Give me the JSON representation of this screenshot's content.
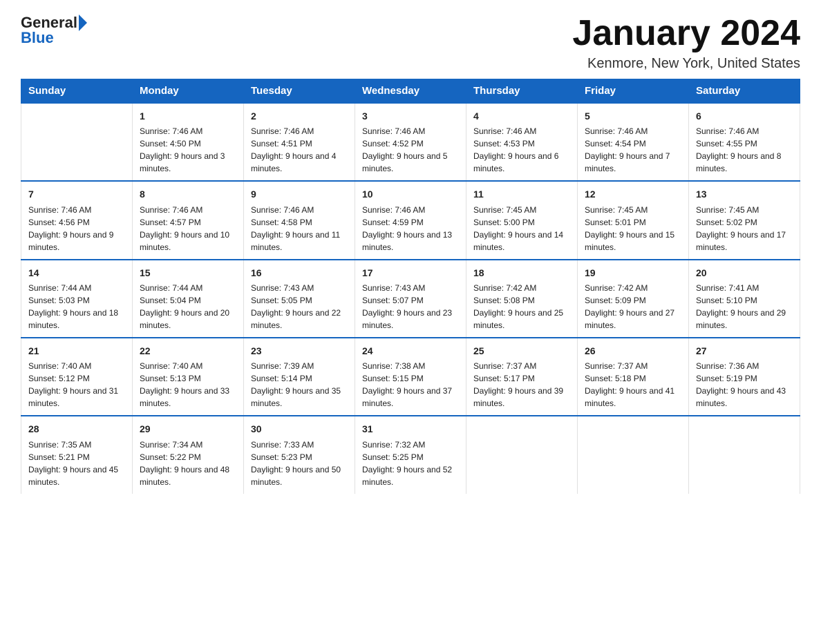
{
  "header": {
    "logo": {
      "text_general": "General",
      "arrow_label": "arrow-icon",
      "text_blue": "Blue"
    },
    "title": "January 2024",
    "location": "Kenmore, New York, United States"
  },
  "calendar": {
    "weekdays": [
      "Sunday",
      "Monday",
      "Tuesday",
      "Wednesday",
      "Thursday",
      "Friday",
      "Saturday"
    ],
    "weeks": [
      [
        {
          "day": "",
          "sunrise": "",
          "sunset": "",
          "daylight": ""
        },
        {
          "day": "1",
          "sunrise": "Sunrise: 7:46 AM",
          "sunset": "Sunset: 4:50 PM",
          "daylight": "Daylight: 9 hours and 3 minutes."
        },
        {
          "day": "2",
          "sunrise": "Sunrise: 7:46 AM",
          "sunset": "Sunset: 4:51 PM",
          "daylight": "Daylight: 9 hours and 4 minutes."
        },
        {
          "day": "3",
          "sunrise": "Sunrise: 7:46 AM",
          "sunset": "Sunset: 4:52 PM",
          "daylight": "Daylight: 9 hours and 5 minutes."
        },
        {
          "day": "4",
          "sunrise": "Sunrise: 7:46 AM",
          "sunset": "Sunset: 4:53 PM",
          "daylight": "Daylight: 9 hours and 6 minutes."
        },
        {
          "day": "5",
          "sunrise": "Sunrise: 7:46 AM",
          "sunset": "Sunset: 4:54 PM",
          "daylight": "Daylight: 9 hours and 7 minutes."
        },
        {
          "day": "6",
          "sunrise": "Sunrise: 7:46 AM",
          "sunset": "Sunset: 4:55 PM",
          "daylight": "Daylight: 9 hours and 8 minutes."
        }
      ],
      [
        {
          "day": "7",
          "sunrise": "Sunrise: 7:46 AM",
          "sunset": "Sunset: 4:56 PM",
          "daylight": "Daylight: 9 hours and 9 minutes."
        },
        {
          "day": "8",
          "sunrise": "Sunrise: 7:46 AM",
          "sunset": "Sunset: 4:57 PM",
          "daylight": "Daylight: 9 hours and 10 minutes."
        },
        {
          "day": "9",
          "sunrise": "Sunrise: 7:46 AM",
          "sunset": "Sunset: 4:58 PM",
          "daylight": "Daylight: 9 hours and 11 minutes."
        },
        {
          "day": "10",
          "sunrise": "Sunrise: 7:46 AM",
          "sunset": "Sunset: 4:59 PM",
          "daylight": "Daylight: 9 hours and 13 minutes."
        },
        {
          "day": "11",
          "sunrise": "Sunrise: 7:45 AM",
          "sunset": "Sunset: 5:00 PM",
          "daylight": "Daylight: 9 hours and 14 minutes."
        },
        {
          "day": "12",
          "sunrise": "Sunrise: 7:45 AM",
          "sunset": "Sunset: 5:01 PM",
          "daylight": "Daylight: 9 hours and 15 minutes."
        },
        {
          "day": "13",
          "sunrise": "Sunrise: 7:45 AM",
          "sunset": "Sunset: 5:02 PM",
          "daylight": "Daylight: 9 hours and 17 minutes."
        }
      ],
      [
        {
          "day": "14",
          "sunrise": "Sunrise: 7:44 AM",
          "sunset": "Sunset: 5:03 PM",
          "daylight": "Daylight: 9 hours and 18 minutes."
        },
        {
          "day": "15",
          "sunrise": "Sunrise: 7:44 AM",
          "sunset": "Sunset: 5:04 PM",
          "daylight": "Daylight: 9 hours and 20 minutes."
        },
        {
          "day": "16",
          "sunrise": "Sunrise: 7:43 AM",
          "sunset": "Sunset: 5:05 PM",
          "daylight": "Daylight: 9 hours and 22 minutes."
        },
        {
          "day": "17",
          "sunrise": "Sunrise: 7:43 AM",
          "sunset": "Sunset: 5:07 PM",
          "daylight": "Daylight: 9 hours and 23 minutes."
        },
        {
          "day": "18",
          "sunrise": "Sunrise: 7:42 AM",
          "sunset": "Sunset: 5:08 PM",
          "daylight": "Daylight: 9 hours and 25 minutes."
        },
        {
          "day": "19",
          "sunrise": "Sunrise: 7:42 AM",
          "sunset": "Sunset: 5:09 PM",
          "daylight": "Daylight: 9 hours and 27 minutes."
        },
        {
          "day": "20",
          "sunrise": "Sunrise: 7:41 AM",
          "sunset": "Sunset: 5:10 PM",
          "daylight": "Daylight: 9 hours and 29 minutes."
        }
      ],
      [
        {
          "day": "21",
          "sunrise": "Sunrise: 7:40 AM",
          "sunset": "Sunset: 5:12 PM",
          "daylight": "Daylight: 9 hours and 31 minutes."
        },
        {
          "day": "22",
          "sunrise": "Sunrise: 7:40 AM",
          "sunset": "Sunset: 5:13 PM",
          "daylight": "Daylight: 9 hours and 33 minutes."
        },
        {
          "day": "23",
          "sunrise": "Sunrise: 7:39 AM",
          "sunset": "Sunset: 5:14 PM",
          "daylight": "Daylight: 9 hours and 35 minutes."
        },
        {
          "day": "24",
          "sunrise": "Sunrise: 7:38 AM",
          "sunset": "Sunset: 5:15 PM",
          "daylight": "Daylight: 9 hours and 37 minutes."
        },
        {
          "day": "25",
          "sunrise": "Sunrise: 7:37 AM",
          "sunset": "Sunset: 5:17 PM",
          "daylight": "Daylight: 9 hours and 39 minutes."
        },
        {
          "day": "26",
          "sunrise": "Sunrise: 7:37 AM",
          "sunset": "Sunset: 5:18 PM",
          "daylight": "Daylight: 9 hours and 41 minutes."
        },
        {
          "day": "27",
          "sunrise": "Sunrise: 7:36 AM",
          "sunset": "Sunset: 5:19 PM",
          "daylight": "Daylight: 9 hours and 43 minutes."
        }
      ],
      [
        {
          "day": "28",
          "sunrise": "Sunrise: 7:35 AM",
          "sunset": "Sunset: 5:21 PM",
          "daylight": "Daylight: 9 hours and 45 minutes."
        },
        {
          "day": "29",
          "sunrise": "Sunrise: 7:34 AM",
          "sunset": "Sunset: 5:22 PM",
          "daylight": "Daylight: 9 hours and 48 minutes."
        },
        {
          "day": "30",
          "sunrise": "Sunrise: 7:33 AM",
          "sunset": "Sunset: 5:23 PM",
          "daylight": "Daylight: 9 hours and 50 minutes."
        },
        {
          "day": "31",
          "sunrise": "Sunrise: 7:32 AM",
          "sunset": "Sunset: 5:25 PM",
          "daylight": "Daylight: 9 hours and 52 minutes."
        },
        {
          "day": "",
          "sunrise": "",
          "sunset": "",
          "daylight": ""
        },
        {
          "day": "",
          "sunrise": "",
          "sunset": "",
          "daylight": ""
        },
        {
          "day": "",
          "sunrise": "",
          "sunset": "",
          "daylight": ""
        }
      ]
    ]
  }
}
